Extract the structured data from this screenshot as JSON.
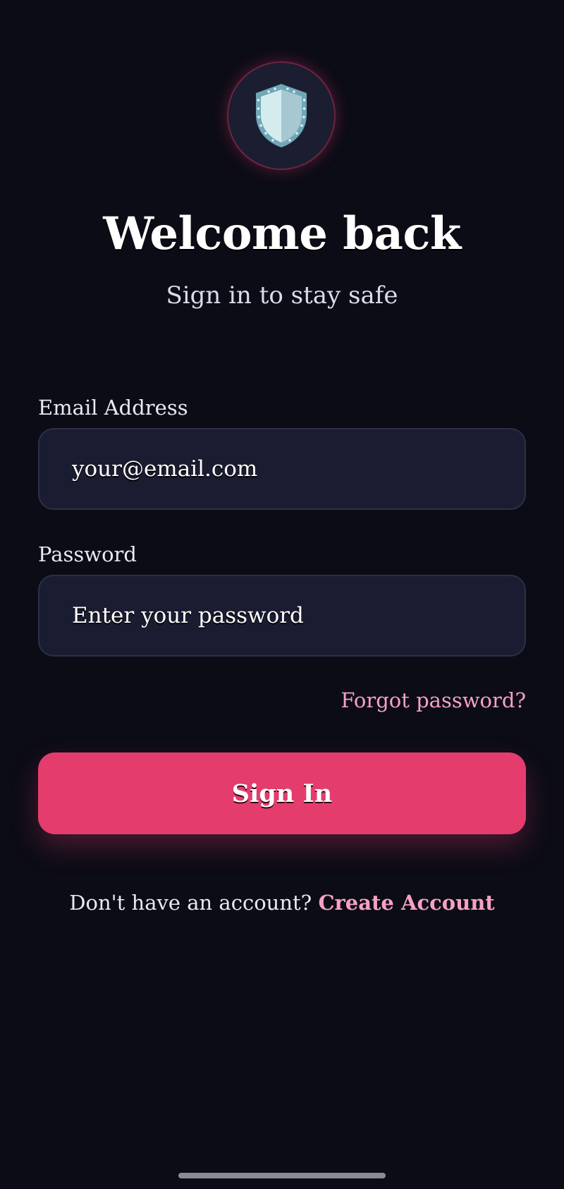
{
  "header": {
    "logo_icon": "shield-icon",
    "title": "Welcome back",
    "subtitle": "Sign in to stay safe"
  },
  "form": {
    "email": {
      "label": "Email Address",
      "placeholder": "your@email.com",
      "value": ""
    },
    "password": {
      "label": "Password",
      "placeholder": "Enter your password",
      "value": ""
    },
    "forgot_label": "Forgot password?",
    "submit_label": "Sign In"
  },
  "footer": {
    "prompt": "Don't have an account?",
    "create_label": "Create Account"
  },
  "colors": {
    "background": "#0b0c16",
    "field_background": "#1a1c31",
    "accent": "#e53c6e",
    "link": "#f7a1c2"
  }
}
